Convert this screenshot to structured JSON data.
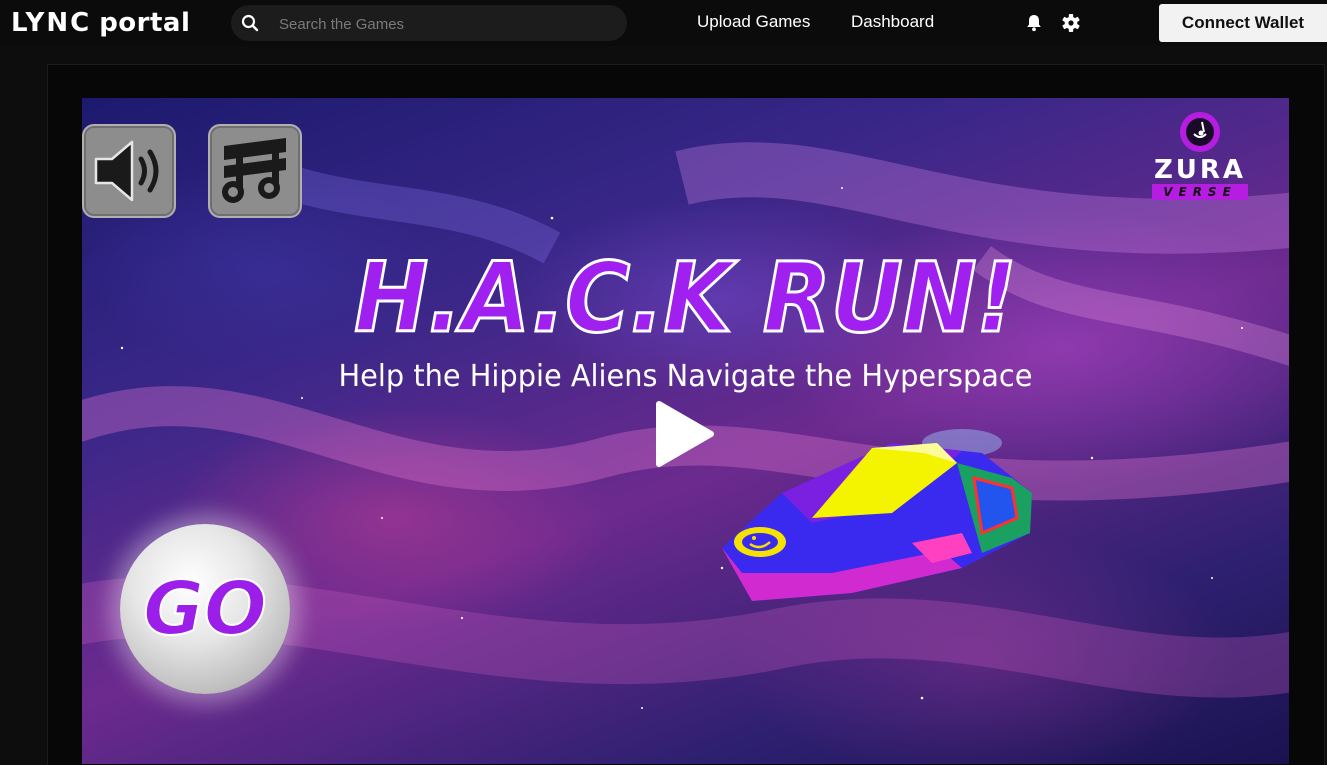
{
  "header": {
    "logo_brand": "LYNC",
    "logo_product": "portal",
    "search_placeholder": "Search the Games",
    "nav": {
      "upload_games": "Upload Games",
      "dashboard": "Dashboard"
    },
    "icons": [
      "search-icon",
      "bell-icon",
      "gear-icon"
    ],
    "connect_wallet": "Connect Wallet"
  },
  "game": {
    "title": "H.A.C.K RUN!",
    "tagline": "Help the Hippie Aliens Navigate the Hyperspace",
    "go_label": "GO",
    "publisher_logo": {
      "word": "ZURA",
      "sub": "VERSE"
    },
    "buttons": [
      "speaker-icon",
      "music-note-icon",
      "play-icon"
    ]
  },
  "colors": {
    "topbar_bg": "#0b0b0b",
    "title_purple": "#a020f0",
    "zura_purple": "#b51ee0",
    "wallet_button_bg": "#f2f2f2"
  }
}
